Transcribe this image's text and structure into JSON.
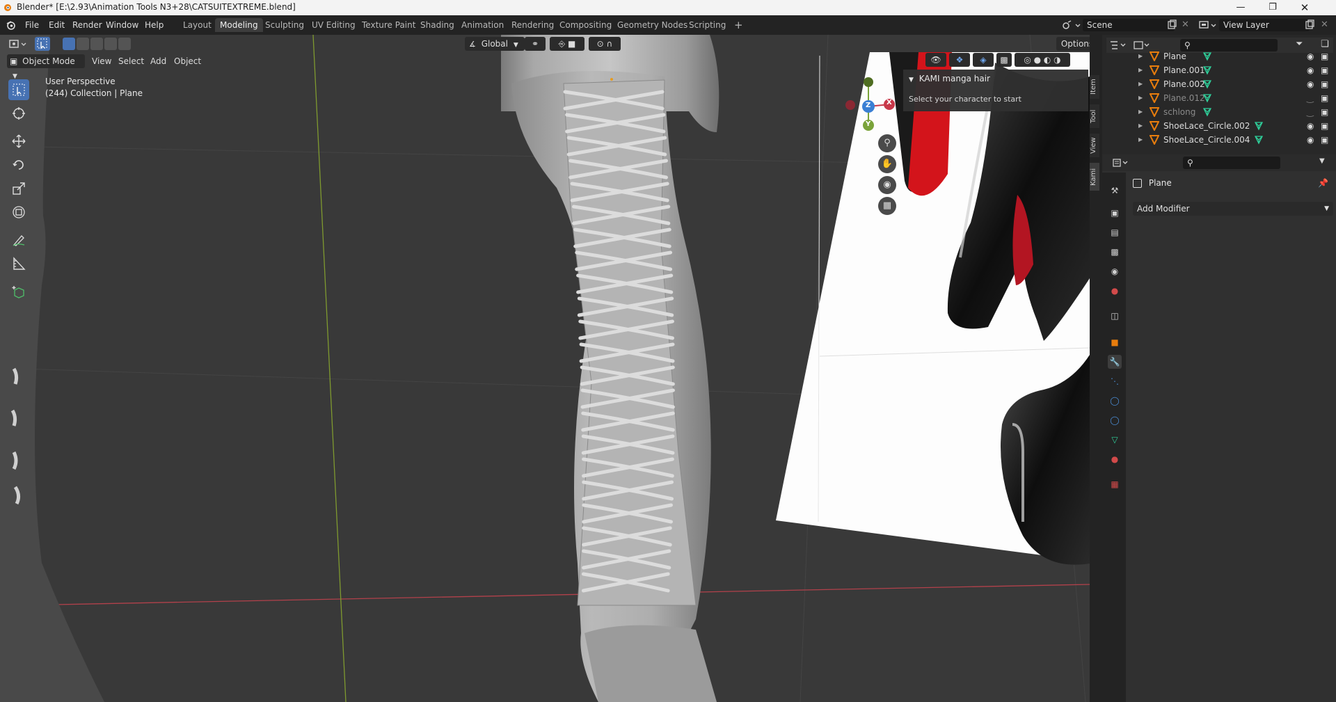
{
  "window": {
    "title": "Blender* [E:\\2.93\\Animation Tools N3+28\\CATSUITEXTREME.blend]"
  },
  "menubar": {
    "items": [
      "File",
      "Edit",
      "Render",
      "Window",
      "Help"
    ]
  },
  "workspaces": {
    "tabs": [
      "Layout",
      "Modeling",
      "Sculpting",
      "UV Editing",
      "Texture Paint",
      "Shading",
      "Animation",
      "Rendering",
      "Compositing",
      "Geometry Nodes",
      "Scripting"
    ],
    "active": "Modeling",
    "add": "+"
  },
  "scene": {
    "label": "Scene"
  },
  "view_layer": {
    "label": "View Layer"
  },
  "viewport_header": {
    "mode": "Object Mode",
    "menus": [
      "View",
      "Select",
      "Add",
      "Object"
    ],
    "orientation": "Global",
    "options": "Options"
  },
  "viewport": {
    "perspective": "User Perspective",
    "collection_info": "(244) Collection | Plane"
  },
  "gizmo": {
    "x": "X",
    "y": "Y",
    "z": "Z"
  },
  "npanel": {
    "tabs": [
      "Item",
      "Tool",
      "View",
      "Kami"
    ],
    "panel_title": "KAMI manga hair",
    "panel_text": "Select your character to start"
  },
  "outliner": {
    "rows": [
      {
        "name": "Plane",
        "dim": false
      },
      {
        "name": "Plane.001",
        "dim": false
      },
      {
        "name": "Plane.002",
        "dim": false
      },
      {
        "name": "Plane.012",
        "dim": true
      },
      {
        "name": "schlong",
        "dim": true
      },
      {
        "name": "ShoeLace_Circle.002",
        "dim": false
      },
      {
        "name": "ShoeLace_Circle.004",
        "dim": false
      }
    ]
  },
  "properties": {
    "object_name": "Plane",
    "add_modifier": "Add Modifier"
  },
  "colors": {
    "accent": "#4772b3",
    "active_tab_icon": "#4b8dd6",
    "viewport_bg": "#393939",
    "x_axis": "#c8394a",
    "y_axis": "#7aa33a",
    "z_axis": "#3a7fd4"
  }
}
